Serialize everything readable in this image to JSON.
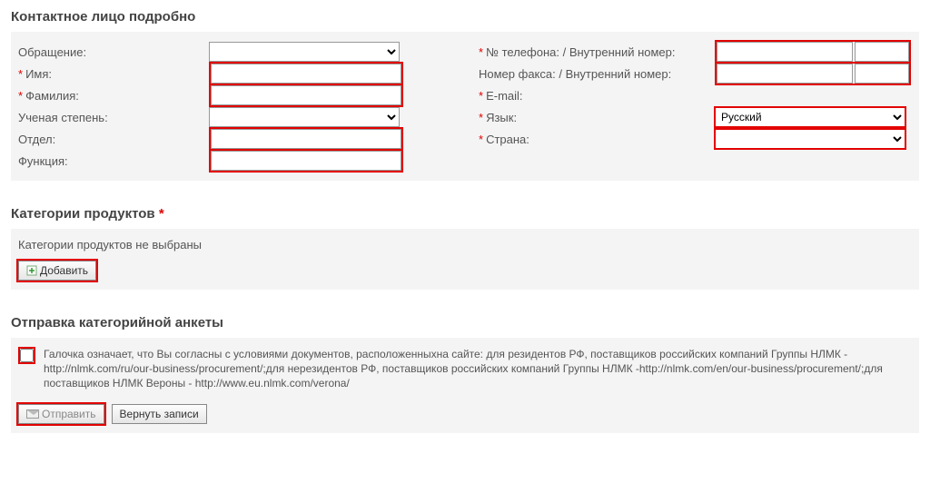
{
  "sections": {
    "contact_title": "Контактное лицо подробно",
    "categories_title": "Категории продуктов",
    "send_title": "Отправка категорийной анкеты"
  },
  "labels": {
    "salutation": "Обращение:",
    "first_name": "Имя:",
    "last_name": "Фамилия:",
    "degree": "Ученая степень:",
    "department": "Отдел:",
    "function": "Функция:",
    "phone": "№ телефона:  / Внутренний номер:",
    "fax": "Номер факса:  / Внутренний номер:",
    "email": "E-mail:",
    "language": "Язык:",
    "country": "Страна:"
  },
  "values": {
    "language": "Русский"
  },
  "categories_note": "Категории продуктов не выбраны",
  "buttons": {
    "add": "Добавить",
    "send": "Отправить",
    "revert": "Вернуть записи"
  },
  "terms_text": "Галочка означает, что Вы согласны с условиями документов, расположенныхна сайте: для резидентов РФ, поставщиков российских компаний Группы НЛМК -http://nlmk.com/ru/our-business/procurement/;для нерезидентов РФ, поставщиков российских компаний Группы НЛМК -http://nlmk.com/en/our-business/procurement/;для поставщиков НЛМК Вероны - http://www.eu.nlmk.com/verona/"
}
